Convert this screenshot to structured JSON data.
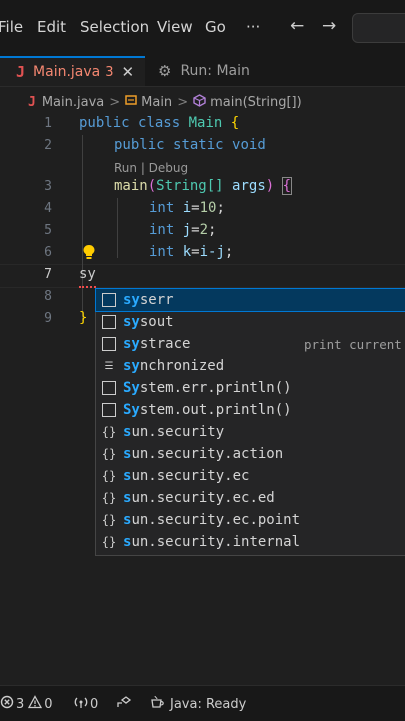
{
  "menubar": {
    "items": [
      "File",
      "Edit",
      "Selection",
      "View",
      "Go",
      "···"
    ],
    "back": "←",
    "forward": "→"
  },
  "tabs": [
    {
      "icon": "J",
      "title": "Main.java",
      "problems": "3",
      "close": "✕"
    },
    {
      "icon": "gear-icon",
      "title": "Run: Main"
    }
  ],
  "breadcrumb": {
    "file": "Main.java",
    "sep": ">",
    "class": "Main",
    "method": "main(String[])"
  },
  "editor": {
    "line_numbers": [
      "1",
      "2",
      "3",
      "4",
      "5",
      "6",
      "7",
      "8",
      "9"
    ],
    "code_lens": "Run | Debug",
    "lines": {
      "l1_kw1": "public",
      "l1_kw2": "class",
      "l1_name": "Main",
      "l1_brace": "{",
      "l2_kw1": "public",
      "l2_kw2": "static",
      "l2_kw3": "void",
      "l3_fn": "main",
      "l3_paren": "(",
      "l3_type": "String[]",
      "l3_arg": "args",
      "l3_close": ")",
      "l3_brace": "{",
      "l4_kw": "int",
      "l4_var": "i",
      "l4_eq": "=",
      "l4_num": "10",
      "l4_semi": ";",
      "l5_kw": "int",
      "l5_var": "j",
      "l5_eq": "=",
      "l5_num": "2",
      "l5_semi": ";",
      "l6_kw": "int",
      "l6_var": "k",
      "l6_eq": "=",
      "l6_expr": "i-j",
      "l6_semi": ";",
      "l7_text": "sy",
      "l9_brace": "}"
    }
  },
  "suggestions": [
    {
      "kind": "snippet",
      "match": "sy",
      "rest": "serr",
      "detail": ""
    },
    {
      "kind": "snippet",
      "match": "sy",
      "rest": "sout",
      "detail": ""
    },
    {
      "kind": "snippet",
      "match": "sy",
      "rest": "strace",
      "detail": "print current"
    },
    {
      "kind": "keyword",
      "match": "sy",
      "rest": "nchronized",
      "detail": ""
    },
    {
      "kind": "snippet",
      "match": "Sy",
      "rest": "stem.err.println()",
      "detail": ""
    },
    {
      "kind": "snippet",
      "match": "Sy",
      "rest": "stem.out.println()",
      "detail": ""
    },
    {
      "kind": "module",
      "match": "s",
      "rest": "un.security",
      "detail": ""
    },
    {
      "kind": "module",
      "match": "s",
      "rest": "un.security.action",
      "detail": ""
    },
    {
      "kind": "module",
      "match": "s",
      "rest": "un.security.ec",
      "detail": ""
    },
    {
      "kind": "module",
      "match": "s",
      "rest": "un.security.ec.ed",
      "detail": ""
    },
    {
      "kind": "module",
      "match": "s",
      "rest": "un.security.ec.point",
      "detail": ""
    },
    {
      "kind": "module",
      "match": "s",
      "rest": "un.security.internal",
      "detail": ""
    }
  ],
  "statusbar": {
    "errors": "3",
    "warnings": "0",
    "ports": "0",
    "java_status": "Java: Ready"
  },
  "colors": {
    "accent": "#0078d4",
    "error": "#f48771",
    "keyword": "#569cd6",
    "type": "#4ec9b0",
    "highlight": "#2aaaff"
  }
}
